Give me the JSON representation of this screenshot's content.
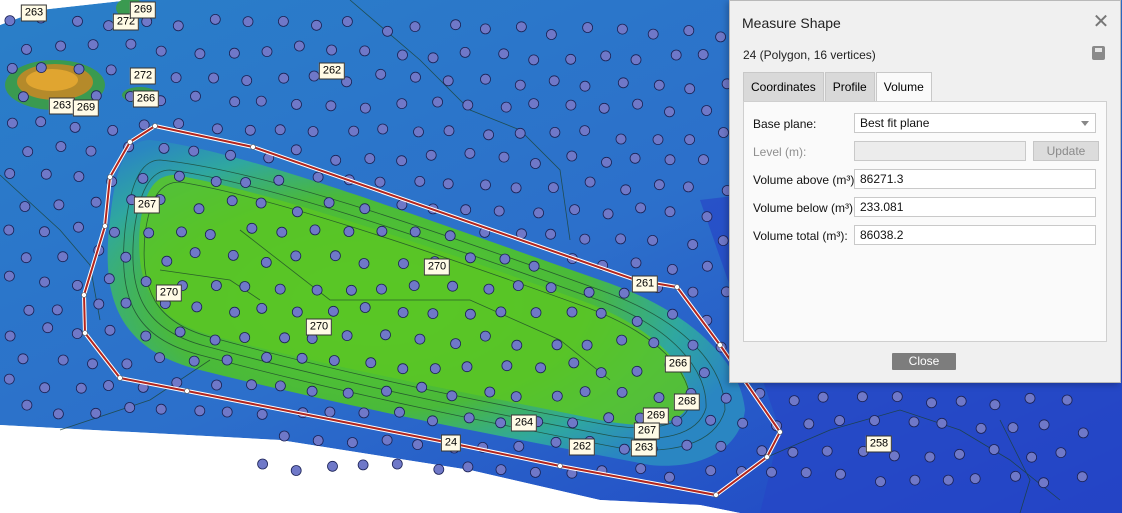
{
  "map": {
    "polygon_label": "24",
    "contour_labels": [
      "263",
      "272",
      "269",
      "272",
      "266",
      "263",
      "269",
      "262",
      "267",
      "270",
      "270",
      "270",
      "261",
      "266",
      "268",
      "269",
      "267",
      "263",
      "264",
      "262",
      "258"
    ]
  },
  "dialog": {
    "title": "Measure Shape",
    "subtitle": "24 (Polygon, 16 vertices)",
    "tabs": [
      "Coordinates",
      "Profile",
      "Volume"
    ],
    "active_tab": "Volume",
    "base_plane_label": "Base plane:",
    "base_plane_value": "Best fit plane",
    "level_label": "Level (m):",
    "level_value": "",
    "update_label": "Update",
    "volume_above_label": "Volume above (m³):",
    "volume_above_value": "86271.3",
    "volume_below_label": "Volume below (m³):",
    "volume_below_value": "233.081",
    "volume_total_label": "Volume total (m³):",
    "volume_total_value": "86038.2",
    "close_label": "Close"
  },
  "colors": {
    "deep_water": "#1f3fc4",
    "shallow_water": "#2f8fc8",
    "shoal": "#4fc23a",
    "peak": "#d6a12a",
    "polygon_outline": "#c0392b"
  }
}
